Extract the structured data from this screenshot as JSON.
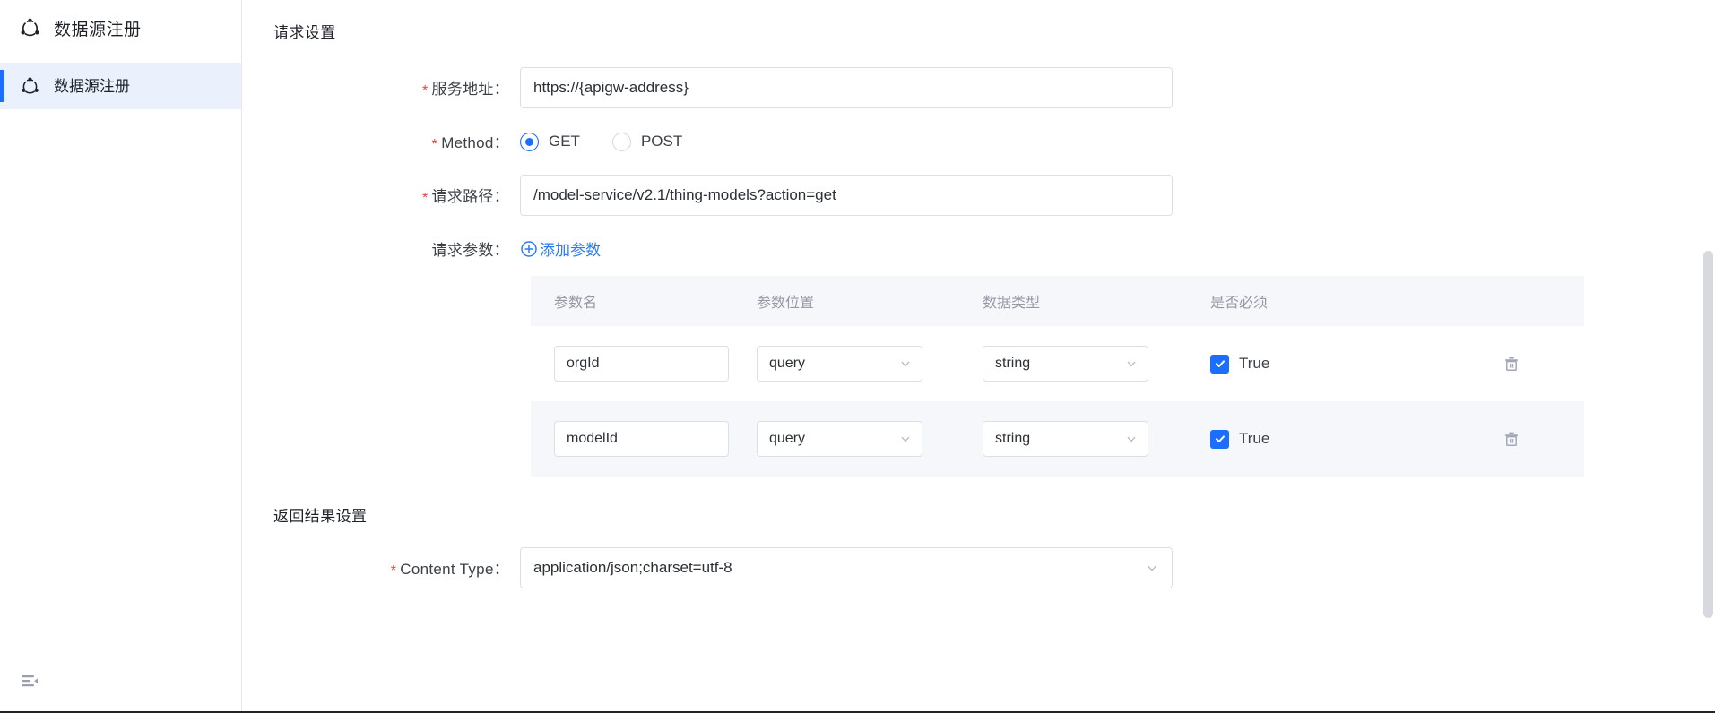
{
  "sidebar": {
    "brand": {
      "icon": "datasource-icon",
      "title": "数据源注册"
    },
    "items": [
      {
        "icon": "datasource-icon",
        "label": "数据源注册",
        "active": true
      }
    ],
    "collapse_icon": "menu-fold-icon"
  },
  "main": {
    "request_section_title": "请求设置",
    "fields": {
      "service_address": {
        "label": "服务地址：",
        "required": true,
        "value": "https://{apigw-address}",
        "placeholder": "https://{apigw-address}"
      },
      "method": {
        "label": "Method：",
        "required": true,
        "selected": "GET",
        "options": [
          "GET",
          "POST"
        ]
      },
      "request_path": {
        "label": "请求路径：",
        "required": true,
        "value": "/model-service/v2.1/thing-models?action=get",
        "placeholder": "/model-service/v2.1/thing-models?action=get"
      },
      "request_params": {
        "label": "请求参数：",
        "required": false,
        "add_link": "添加参数",
        "add_icon": "plus-circle-icon"
      }
    },
    "param_table": {
      "columns": [
        "参数名",
        "参数位置",
        "数据类型",
        "是否必须"
      ],
      "rows": [
        {
          "name": "orgId",
          "position": "query",
          "type": "string",
          "required_label": "True",
          "required_checked": true,
          "delete_icon": "trash-icon"
        },
        {
          "name": "modelId",
          "position": "query",
          "type": "string",
          "required_label": "True",
          "required_checked": true,
          "delete_icon": "trash-icon"
        }
      ]
    },
    "result_section_title": "返回结果设置",
    "content_type": {
      "label": "Content Type：",
      "required": true,
      "value": "application/json;charset=utf-8",
      "options": [
        "application/json;charset=utf-8"
      ]
    }
  },
  "colors": {
    "accent": "#1b6eff",
    "link": "#2a7cf6",
    "required_star": "#e8413c",
    "active_nav_bg": "#eaf1fd",
    "table_header_bg": "#f6f7fa",
    "border": "#dcdfe6"
  }
}
